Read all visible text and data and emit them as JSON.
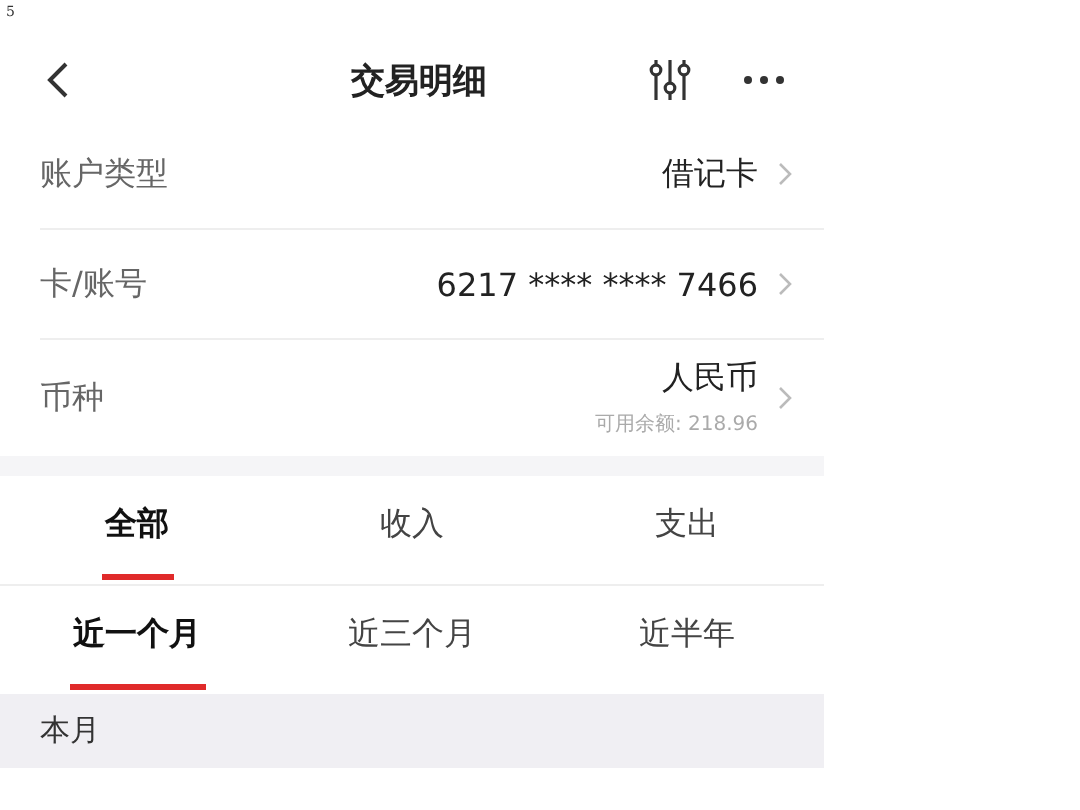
{
  "page_number": "5",
  "header": {
    "title": "交易明细"
  },
  "fields": [
    {
      "label": "账户类型",
      "value": "借记卡"
    },
    {
      "label": "卡/账号",
      "value": "6217 **** **** 7466"
    },
    {
      "label": "币种",
      "value": "人民币",
      "note": "可用余额: 218.96"
    }
  ],
  "tabs": [
    {
      "label": "全部",
      "selected": true
    },
    {
      "label": "收入",
      "selected": false
    },
    {
      "label": "支出",
      "selected": false
    }
  ],
  "periods": [
    {
      "label": "近一个月",
      "selected": true
    },
    {
      "label": "近三个月",
      "selected": false
    },
    {
      "label": "近半年",
      "selected": false
    }
  ],
  "section_header": "本月"
}
